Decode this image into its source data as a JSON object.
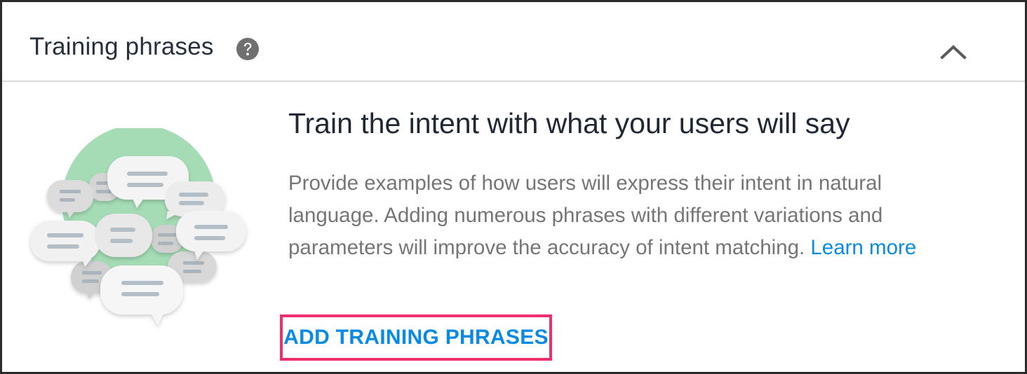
{
  "header": {
    "title": "Training phrases",
    "help_icon": "help-circle-icon",
    "collapse_icon": "chevron-up-icon"
  },
  "empty_state": {
    "illustration": "chat-bubbles-illustration",
    "title": "Train the intent with what your users will say",
    "description": "Provide examples of how users will express their intent in natural language. Adding numerous phrases with different variations and parameters will improve the accuracy of intent matching.",
    "learn_more_label": "Learn more",
    "add_button_label": "ADD TRAINING PHRASES"
  },
  "colors": {
    "accent": "#0a8be3",
    "highlight_border": "#ee2f6b",
    "illustration_green": "#a5dcb6",
    "text_primary": "#27313d",
    "text_secondary": "#757575"
  }
}
